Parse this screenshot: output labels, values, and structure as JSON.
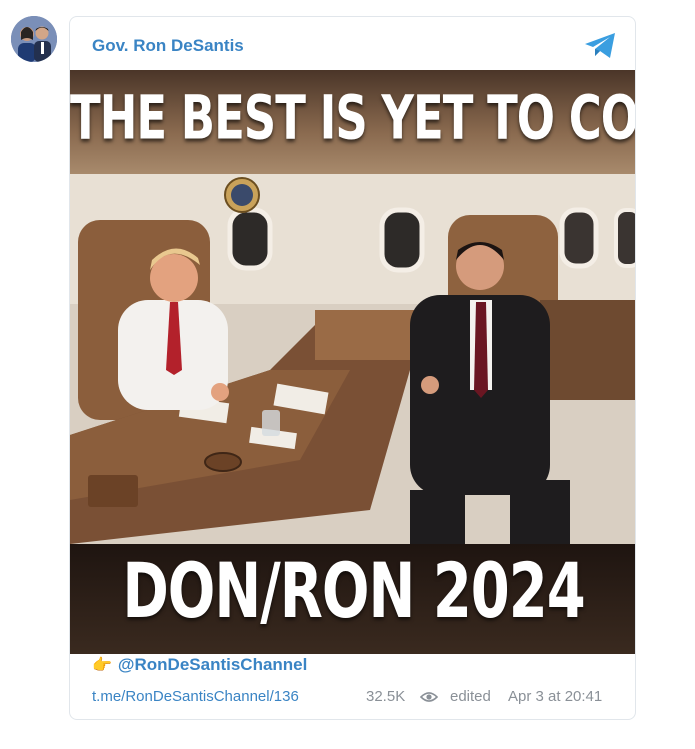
{
  "author": {
    "name": "Gov. Ron DeSantis",
    "avatar": "avatar"
  },
  "header": {
    "icon": "telegram-icon"
  },
  "image": {
    "top_text": "THE BEST IS YET TO COME",
    "bottom_text": "DON/RON 2024"
  },
  "channel": {
    "pointing_icon": "👉",
    "handle": "@RonDeSantisChannel"
  },
  "meta": {
    "post_link": "t.me/RonDeSantisChannel/136",
    "views": "32.5K",
    "views_icon": "eye-icon",
    "edited_label": "edited",
    "date": "Apr 3 at 20:41"
  },
  "colors": {
    "link": "#3a84c4",
    "muted": "#8a9097",
    "border": "#e1e6eb"
  }
}
